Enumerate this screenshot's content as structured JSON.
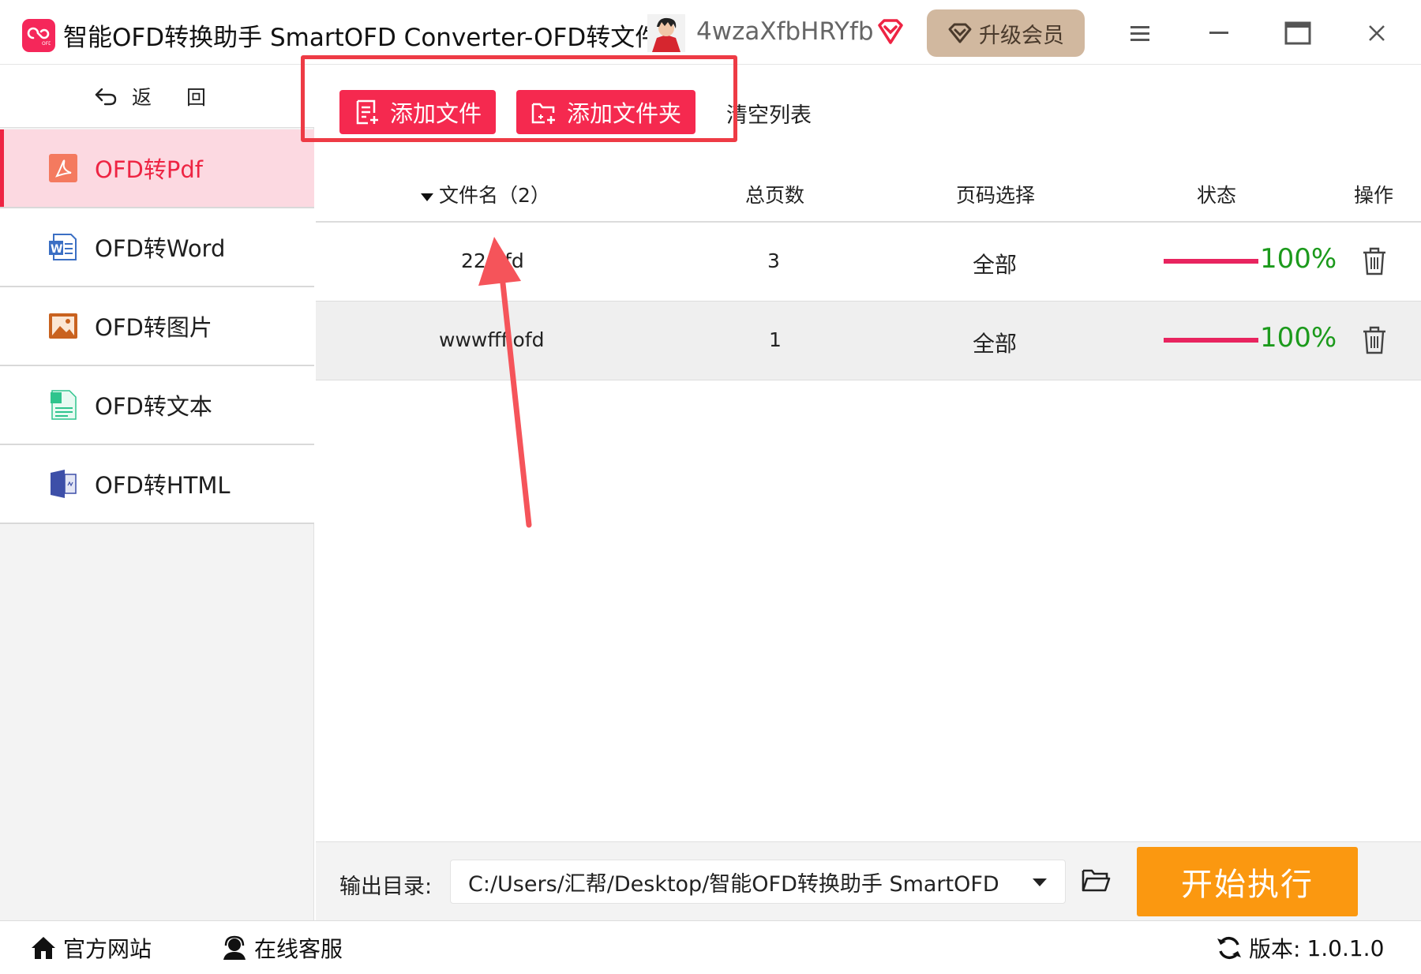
{
  "titlebar": {
    "title": "智能OFD转换助手 SmartOFD Converter-OFD转文件",
    "username": "4wzaXfbHRYfb",
    "upgrade_label": "升级会员",
    "brand_color": "#f5275a",
    "upgrade_bg": "#d1b89f"
  },
  "sidebar": {
    "back_label": "返 回",
    "items": [
      {
        "label": "OFD转Pdf",
        "icon": "pdf-icon",
        "active": true
      },
      {
        "label": "OFD转Word",
        "icon": "word-icon",
        "active": false
      },
      {
        "label": "OFD转图片",
        "icon": "image-icon",
        "active": false
      },
      {
        "label": "OFD转文本",
        "icon": "text-file-icon",
        "active": false
      },
      {
        "label": "OFD转HTML",
        "icon": "html-file-icon",
        "active": false
      }
    ],
    "active_color": "#ee2443",
    "active_bg": "#fcd9e1"
  },
  "toolbar": {
    "add_file_label": "添加文件",
    "add_folder_label": "添加文件夹",
    "clear_label": "清空列表",
    "button_color": "#f5294f"
  },
  "table": {
    "headers": {
      "filename": "文件名（2）",
      "pages": "总页数",
      "page_select": "页码选择",
      "status": "状态",
      "actions": "操作"
    },
    "rows": [
      {
        "filename": "22.ofd",
        "pages": "3",
        "page_select": "全部",
        "progress": 1.0,
        "status": "100%"
      },
      {
        "filename": "wwwfff.ofd",
        "pages": "1",
        "page_select": "全部",
        "progress": 1.0,
        "status": "100%"
      }
    ],
    "status_color": "#1c9a1c",
    "progress_color": "#e8245f"
  },
  "output": {
    "label": "输出目录:",
    "path": "C:/Users/汇帮/Desktop/智能OFD转换助手 SmartOFD",
    "start_label": "开始执行",
    "start_color": "#fb9810"
  },
  "footer": {
    "website_label": "官方网站",
    "support_label": "在线客服",
    "version_label": "版本:",
    "version_value": "1.0.1.0"
  }
}
